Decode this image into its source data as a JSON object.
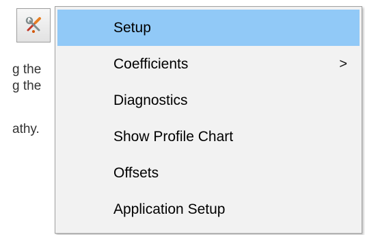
{
  "background_text": {
    "line1": "g the",
    "line2": "g the",
    "line3": "athy."
  },
  "toolbar": {
    "tool_icon": "wrench-screwdriver-icon"
  },
  "menu": {
    "items": [
      {
        "label": "Setup",
        "highlighted": true,
        "has_submenu": false
      },
      {
        "label": "Coefficients",
        "highlighted": false,
        "has_submenu": true,
        "submenu_glyph": ">"
      },
      {
        "label": "Diagnostics",
        "highlighted": false,
        "has_submenu": false
      },
      {
        "label": "Show Profile Chart",
        "highlighted": false,
        "has_submenu": false
      },
      {
        "label": "Offsets",
        "highlighted": false,
        "has_submenu": false
      },
      {
        "label": "Application Setup",
        "highlighted": false,
        "has_submenu": false
      }
    ]
  },
  "colors": {
    "menu_background": "#f2f2f2",
    "highlight": "#91c9f7",
    "menu_border": "#a0a0a0"
  }
}
